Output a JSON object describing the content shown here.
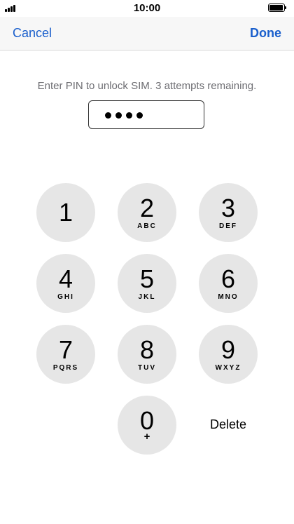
{
  "status_bar": {
    "time": "10:00"
  },
  "nav": {
    "cancel_label": "Cancel",
    "done_label": "Done"
  },
  "prompt": {
    "text": "Enter PIN to unlock SIM. 3 attempts remaining."
  },
  "pin": {
    "entered_digits": 4
  },
  "keypad": {
    "keys": [
      {
        "digit": "1",
        "letters": ""
      },
      {
        "digit": "2",
        "letters": "ABC"
      },
      {
        "digit": "3",
        "letters": "DEF"
      },
      {
        "digit": "4",
        "letters": "GHI"
      },
      {
        "digit": "5",
        "letters": "JKL"
      },
      {
        "digit": "6",
        "letters": "MNO"
      },
      {
        "digit": "7",
        "letters": "PQRS"
      },
      {
        "digit": "8",
        "letters": "TUV"
      },
      {
        "digit": "9",
        "letters": "WXYZ"
      },
      {
        "digit": "0",
        "letters": "+"
      }
    ],
    "delete_label": "Delete"
  },
  "colors": {
    "accent": "#1a5fcc",
    "key_background": "#e6e6e6",
    "prompt_text": "#6d6d72"
  }
}
